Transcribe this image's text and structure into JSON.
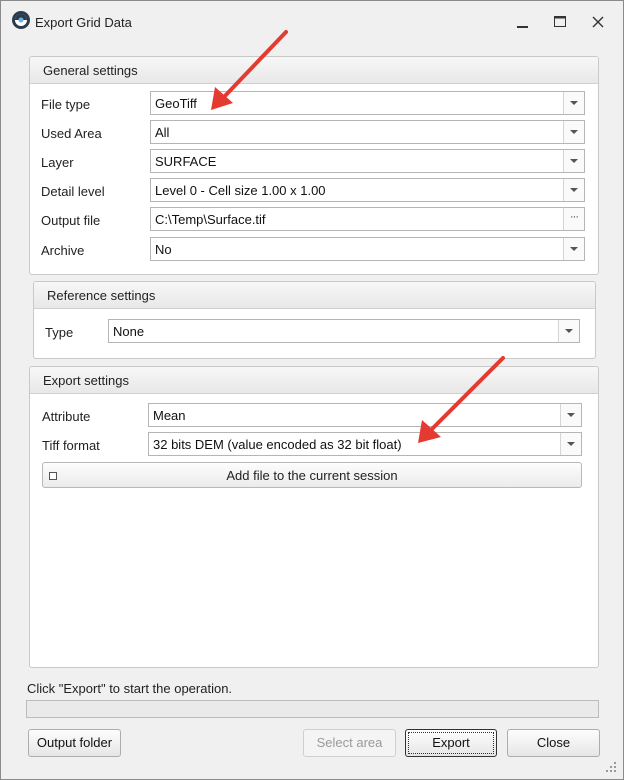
{
  "window": {
    "title": "Export Grid Data",
    "controls": {
      "minimize_icon": "minimize-icon",
      "maximize_icon": "maximize-icon",
      "close_icon": "close-icon"
    }
  },
  "general_settings": {
    "header": "General settings",
    "fields": {
      "file_type": {
        "label": "File type",
        "value": "GeoTiff"
      },
      "used_area": {
        "label": "Used Area",
        "value": "All"
      },
      "layer": {
        "label": "Layer",
        "value": "SURFACE"
      },
      "detail_level": {
        "label": "Detail level",
        "value": "Level 0 - Cell size 1.00 x 1.00"
      },
      "output_file": {
        "label": "Output file",
        "value": "C:\\Temp\\Surface.tif",
        "browse": "···"
      },
      "archive": {
        "label": "Archive",
        "value": "No"
      }
    }
  },
  "reference_settings": {
    "header": "Reference settings",
    "fields": {
      "type": {
        "label": "Type",
        "value": "None"
      }
    }
  },
  "export_settings": {
    "header": "Export settings",
    "fields": {
      "attribute": {
        "label": "Attribute",
        "value": "Mean"
      },
      "tiff_format": {
        "label": "Tiff format",
        "value": "32 bits DEM (value encoded as 32 bit float)"
      }
    },
    "add_to_session": {
      "label": "Add file to the current session",
      "checked": false
    }
  },
  "status": {
    "text": "Click \"Export\" to start the operation.",
    "progress": 0
  },
  "buttons": {
    "output_folder": "Output folder",
    "select_area": "Select area",
    "export": "Export",
    "close": "Close"
  },
  "annotation_color": "#e53a2f"
}
